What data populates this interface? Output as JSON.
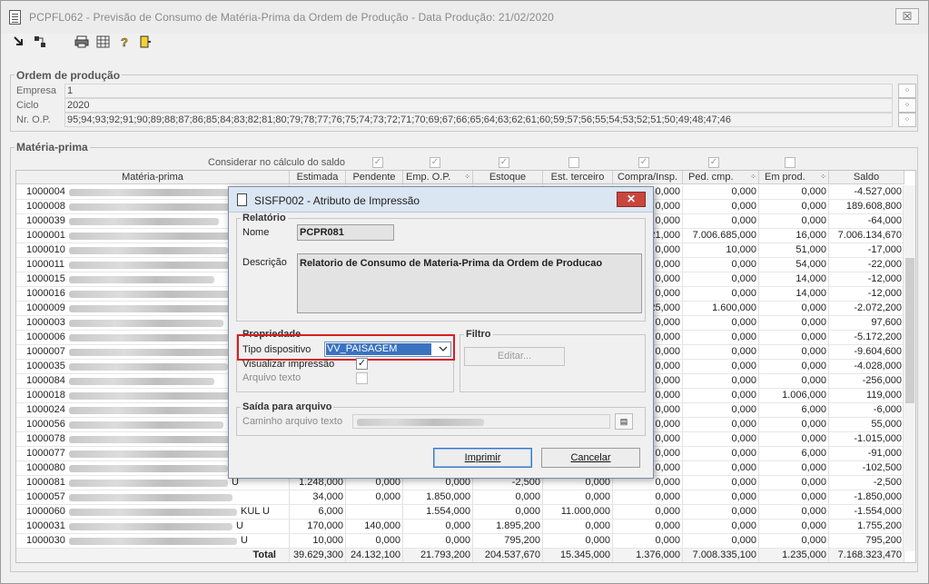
{
  "window": {
    "title": "PCPFL062 - Previsão de Consumo de Matéria-Prima da Ordem de Produção - Data Produção: 21/02/2020",
    "close_label": "☒"
  },
  "toolbar": {
    "icons": [
      "run-icon",
      "tree-icon",
      "print-icon",
      "grid-icon",
      "help-icon",
      "exit-icon"
    ]
  },
  "ordem": {
    "legend": "Ordem de produção",
    "empresa_label": "Empresa",
    "empresa_value": "1",
    "ciclo_label": "Ciclo",
    "ciclo_value": "2020",
    "nrop_label": "Nr. O.P.",
    "nrop_value": "95;94;93;92;91;90;89;88;87;86;85;84;83;82;81;80;79;78;77;76;75;74;73;72;71;70;69;67;66;65;64;63;62;61;60;59;57;56;55;54;53;52;51;50;49;48;47;46"
  },
  "materia": {
    "legend": "Matéria-prima",
    "considerar_label": "Considerar no cálculo do saldo",
    "checks": [
      true,
      true,
      true,
      false,
      true,
      true,
      false
    ]
  },
  "grid": {
    "headers": [
      "Matéria-prima",
      "Estimada",
      "Pendente",
      "Emp. O.P.",
      "Estoque",
      "Est. terceiro",
      "Compra/Insp.",
      "Ped. cmp.",
      "Em prod.",
      "Saldo"
    ],
    "rows": [
      {
        "code": "1000004",
        "suffix": "",
        "estimada": "",
        "pendente": "",
        "emp": "",
        "estoque": "",
        "terceiro": "",
        "compra": "0,000",
        "ped": "0,000",
        "prod": "0,000",
        "saldo": "-4.527,000"
      },
      {
        "code": "1000008",
        "suffix": "",
        "estimada": "",
        "pendente": "",
        "emp": "",
        "estoque": "",
        "terceiro": "",
        "compra": "0,000",
        "ped": "0,000",
        "prod": "0,000",
        "saldo": "189.608,800"
      },
      {
        "code": "1000039",
        "suffix": "",
        "estimada": "",
        "pendente": "",
        "emp": "",
        "estoque": "",
        "terceiro": "",
        "compra": "0,000",
        "ped": "0,000",
        "prod": "0,000",
        "saldo": "-64,000"
      },
      {
        "code": "1000001",
        "suffix": "",
        "estimada": "",
        "pendente": "",
        "emp": "",
        "estoque": "",
        "terceiro": "",
        "compra": "21,000",
        "ped": "7.006.685,000",
        "prod": "16,000",
        "saldo": "7.006.134,670"
      },
      {
        "code": "1000010",
        "suffix": "",
        "estimada": "",
        "pendente": "",
        "emp": "",
        "estoque": "",
        "terceiro": "",
        "compra": "0,000",
        "ped": "10,000",
        "prod": "51,000",
        "saldo": "-17,000"
      },
      {
        "code": "1000011",
        "suffix": "",
        "estimada": "",
        "pendente": "",
        "emp": "",
        "estoque": "",
        "terceiro": "",
        "compra": "0,000",
        "ped": "0,000",
        "prod": "54,000",
        "saldo": "-22,000"
      },
      {
        "code": "1000015",
        "suffix": "",
        "estimada": "",
        "pendente": "",
        "emp": "",
        "estoque": "",
        "terceiro": "",
        "compra": "0,000",
        "ped": "0,000",
        "prod": "14,000",
        "saldo": "-12,000"
      },
      {
        "code": "1000016",
        "suffix": "",
        "estimada": "",
        "pendente": "",
        "emp": "",
        "estoque": "",
        "terceiro": "",
        "compra": "0,000",
        "ped": "0,000",
        "prod": "14,000",
        "saldo": "-12,000"
      },
      {
        "code": "1000009",
        "suffix": "",
        "estimada": "",
        "pendente": "",
        "emp": "",
        "estoque": "",
        "terceiro": "",
        "compra": "25,000",
        "ped": "1.600,000",
        "prod": "0,000",
        "saldo": "-2.072,200"
      },
      {
        "code": "1000003",
        "suffix": "",
        "estimada": "",
        "pendente": "",
        "emp": "",
        "estoque": "",
        "terceiro": "",
        "compra": "0,000",
        "ped": "0,000",
        "prod": "0,000",
        "saldo": "97,600"
      },
      {
        "code": "1000006",
        "suffix": "",
        "estimada": "",
        "pendente": "",
        "emp": "",
        "estoque": "",
        "terceiro": "",
        "compra": "0,000",
        "ped": "0,000",
        "prod": "0,000",
        "saldo": "-5.172,200"
      },
      {
        "code": "1000007",
        "suffix": "",
        "estimada": "",
        "pendente": "",
        "emp": "",
        "estoque": "",
        "terceiro": "",
        "compra": "0,000",
        "ped": "0,000",
        "prod": "0,000",
        "saldo": "-9.604,600"
      },
      {
        "code": "1000035",
        "suffix": "",
        "estimada": "",
        "pendente": "",
        "emp": "",
        "estoque": "",
        "terceiro": "",
        "compra": "0,000",
        "ped": "0,000",
        "prod": "0,000",
        "saldo": "-4.028,000"
      },
      {
        "code": "1000084",
        "suffix": "",
        "estimada": "",
        "pendente": "",
        "emp": "",
        "estoque": "",
        "terceiro": "",
        "compra": "0,000",
        "ped": "0,000",
        "prod": "0,000",
        "saldo": "-256,000"
      },
      {
        "code": "1000018",
        "suffix": "",
        "estimada": "",
        "pendente": "",
        "emp": "",
        "estoque": "",
        "terceiro": "",
        "compra": "0,000",
        "ped": "0,000",
        "prod": "1.006,000",
        "saldo": "119,000"
      },
      {
        "code": "1000024",
        "suffix": "",
        "estimada": "",
        "pendente": "",
        "emp": "",
        "estoque": "",
        "terceiro": "",
        "compra": "0,000",
        "ped": "0,000",
        "prod": "6,000",
        "saldo": "-6,000"
      },
      {
        "code": "1000056",
        "suffix": "",
        "estimada": "",
        "pendente": "",
        "emp": "",
        "estoque": "",
        "terceiro": "",
        "compra": "0,000",
        "ped": "0,000",
        "prod": "0,000",
        "saldo": "55,000"
      },
      {
        "code": "1000078",
        "suffix": "",
        "estimada": "",
        "pendente": "",
        "emp": "",
        "estoque": "",
        "terceiro": "",
        "compra": "0,000",
        "ped": "0,000",
        "prod": "0,000",
        "saldo": "-1.015,000"
      },
      {
        "code": "1000077",
        "suffix": "",
        "estimada": "",
        "pendente": "",
        "emp": "",
        "estoque": "",
        "terceiro": "",
        "compra": "0,000",
        "ped": "0,000",
        "prod": "6,000",
        "saldo": "-91,000"
      },
      {
        "code": "1000080",
        "suffix": "",
        "estimada": "",
        "pendente": "",
        "emp": "",
        "estoque": "",
        "terceiro": "",
        "compra": "0,000",
        "ped": "0,000",
        "prod": "0,000",
        "saldo": "-102,500"
      },
      {
        "code": "1000081",
        "suffix": "U",
        "estimada": "1.248,000",
        "pendente": "0,000",
        "emp": "0,000",
        "estoque": "-2,500",
        "terceiro": "0,000",
        "compra": "0,000",
        "ped": "0,000",
        "prod": "0,000",
        "saldo": "-2,500"
      },
      {
        "code": "1000057",
        "suffix": "",
        "estimada": "34,000",
        "pendente": "0,000",
        "emp": "1.850,000",
        "estoque": "0,000",
        "terceiro": "0,000",
        "compra": "0,000",
        "ped": "0,000",
        "prod": "0,000",
        "saldo": "-1.850,000"
      },
      {
        "code": "1000060",
        "suffix": "KUL U",
        "estimada": "6,000",
        "pendente": "",
        "emp": "1.554,000",
        "estoque": "0,000",
        "terceiro": "11.000,000",
        "compra": "0,000",
        "ped": "0,000",
        "prod": "0,000",
        "saldo": "-1.554,000"
      },
      {
        "code": "1000031",
        "suffix": "U",
        "estimada": "170,000",
        "pendente": "140,000",
        "emp": "0,000",
        "estoque": "1.895,200",
        "terceiro": "0,000",
        "compra": "0,000",
        "ped": "0,000",
        "prod": "0,000",
        "saldo": "1.755,200"
      },
      {
        "code": "1000030",
        "suffix": "U",
        "estimada": "10,000",
        "pendente": "0,000",
        "emp": "0,000",
        "estoque": "795,200",
        "terceiro": "0,000",
        "compra": "0,000",
        "ped": "0,000",
        "prod": "0,000",
        "saldo": "795,200"
      }
    ],
    "total": {
      "label": "Total",
      "estimada": "39.629,300",
      "pendente": "24.132,100",
      "emp": "21.793,200",
      "estoque": "204.537,670",
      "terceiro": "15.345,000",
      "compra": "1.376,000",
      "ped": "7.008.335,100",
      "prod": "1.235,000",
      "saldo": "7.168.323,470"
    }
  },
  "dialog": {
    "title": "SISFP002 - Atributo de Impressão",
    "close_label": "✕",
    "relatorio_title": "Relatório",
    "nome_label": "Nome",
    "nome_value": "PCPR081",
    "descricao_label": "Descrição",
    "descricao_value": "Relatorio de Consumo de Materia-Prima da Ordem de Producao",
    "propriedade_title": "Propriedade",
    "tipo_label": "Tipo dispositivo",
    "tipo_value": "VV_PAISAGEM",
    "visualizar_label": "Visualizar impressão",
    "visualizar_checked": true,
    "arquivo_label": "Arquivo texto",
    "arquivo_checked": false,
    "filtro_title": "Filtro",
    "editar_label": "Editar...",
    "saida_title": "Saída para arquivo",
    "caminho_label": "Caminho arquivo texto",
    "imprimir_label": "Imprimir",
    "cancelar_label": "Cancelar"
  }
}
